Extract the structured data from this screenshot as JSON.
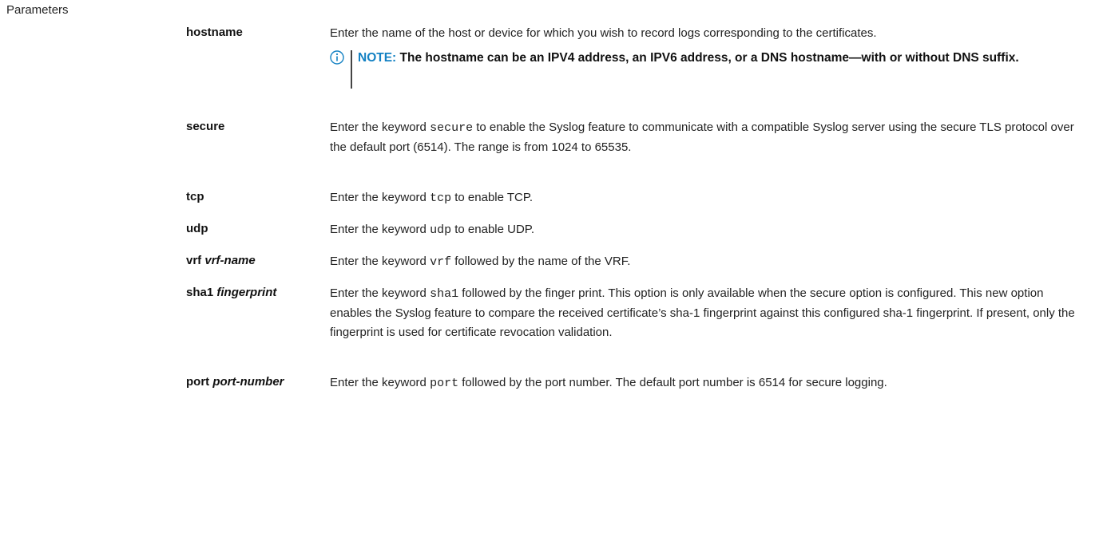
{
  "section_label": "Parameters",
  "params": [
    {
      "name": "hostname",
      "arg": "",
      "desc_parts": [
        "Enter the name of the host or device for which you wish to record logs corresponding to the certificates."
      ]
    },
    {
      "name": "secure",
      "arg": "",
      "desc_parts": [
        "Enter the keyword ",
        "secure",
        " to enable the Syslog feature to communicate with a compatible Syslog server using the secure TLS protocol over the default port (6514). The range is from 1024 to 65535."
      ]
    },
    {
      "name": "tcp",
      "arg": "",
      "desc_parts": [
        "Enter the keyword ",
        "tcp",
        " to enable TCP."
      ]
    },
    {
      "name": "udp",
      "arg": "",
      "desc_parts": [
        "Enter the keyword ",
        "udp",
        " to enable UDP."
      ]
    },
    {
      "name": "vrf",
      "arg": "vrf-name",
      "desc_parts": [
        "Enter the keyword ",
        "vrf",
        " followed by the name of the VRF."
      ]
    },
    {
      "name": "sha1",
      "arg": "fingerprint",
      "desc_parts": [
        "Enter the keyword ",
        "sha1",
        " followed by the finger print. This option is only available when the secure option is configured. This new option enables the Syslog feature to compare the received certificate’s sha-1 fingerprint against this configured sha-1 fingerprint. If present, only the fingerprint is used for certificate revocation validation."
      ]
    },
    {
      "name": "port",
      "arg": "port-number",
      "desc_parts": [
        "Enter the keyword ",
        "port",
        " followed by the port number. The default port number is 6514 for secure logging."
      ]
    }
  ],
  "note": {
    "label": "NOTE:",
    "text": "The hostname can be an IPV4 address, an IPV6 address, or a DNS hostname—with or without DNS suffix."
  },
  "colors": {
    "note_accent": "#1381c3"
  },
  "icons": {
    "note": "info-circle-icon"
  }
}
